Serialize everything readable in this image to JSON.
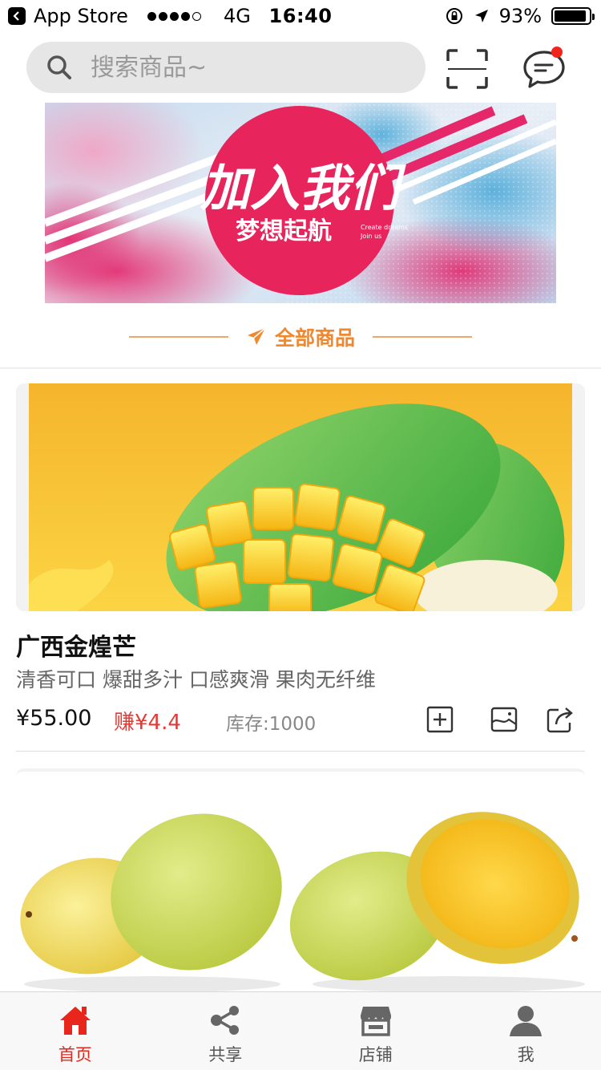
{
  "status_bar": {
    "back_app": "App Store",
    "network": "4G",
    "time": "16:40",
    "battery": "93%",
    "battery_level": 0.93
  },
  "header": {
    "search_placeholder": "搜索商品~",
    "icons": [
      "search-icon",
      "scan-icon",
      "message-icon"
    ],
    "notification_dot_color": "#f0261d"
  },
  "banner": {
    "title": "加入我们",
    "subtitle": "梦想起航",
    "english_line1": "Create dreams",
    "english_line2": "Join us",
    "circle_color": "#e8245c"
  },
  "section": {
    "title": "全部商品",
    "icon": "paper-plane-icon",
    "color": "#f0882f"
  },
  "products": [
    {
      "name": "广西金煌芒",
      "desc": "清香可口 爆甜多汁 口感爽滑 果肉无纤维",
      "price": "¥55.00",
      "earn": "赚¥4.4",
      "stock": "库存:1000",
      "actions": [
        "add-to-cart-icon",
        "image-icon",
        "share-icon"
      ]
    }
  ],
  "tabbar": {
    "items": [
      {
        "label": "首页",
        "icon": "home-icon",
        "active": true
      },
      {
        "label": "共享",
        "icon": "share-nodes-icon",
        "active": false
      },
      {
        "label": "店铺",
        "icon": "store-icon",
        "active": false
      },
      {
        "label": "我",
        "icon": "user-icon",
        "active": false
      }
    ],
    "active_color": "#e8261c"
  }
}
